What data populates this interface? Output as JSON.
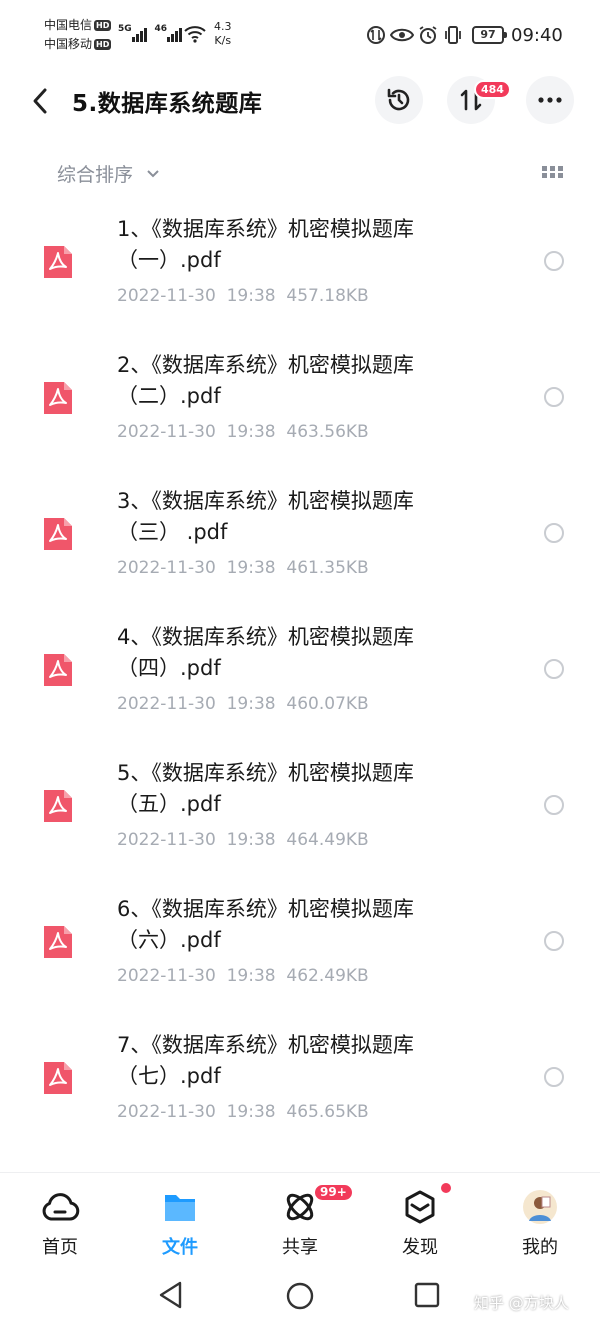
{
  "status": {
    "carrier1": "中国电信",
    "carrier2": "中国移动",
    "hd": "HD",
    "net1": "5G",
    "net2": "46",
    "speed_value": "4.3",
    "speed_unit": "K/s",
    "battery": "97",
    "time": "09:40"
  },
  "header": {
    "title": "5.数据库系统题库",
    "transfer_badge": "484"
  },
  "sort": {
    "label": "综合排序"
  },
  "files": [
    {
      "name_line1": "1、《数据库系统》机密模拟题库",
      "name_line2": "（一）.pdf",
      "date": "2022-11-30",
      "time": "19:38",
      "size": "457.18KB"
    },
    {
      "name_line1": "2、《数据库系统》机密模拟题库",
      "name_line2": "（二）.pdf",
      "date": "2022-11-30",
      "time": "19:38",
      "size": "463.56KB"
    },
    {
      "name_line1": "3、《数据库系统》机密模拟题库",
      "name_line2": "（三） .pdf",
      "date": "2022-11-30",
      "time": "19:38",
      "size": "461.35KB"
    },
    {
      "name_line1": "4、《数据库系统》机密模拟题库",
      "name_line2": "（四）.pdf",
      "date": "2022-11-30",
      "time": "19:38",
      "size": "460.07KB"
    },
    {
      "name_line1": "5、《数据库系统》机密模拟题库",
      "name_line2": "（五）.pdf",
      "date": "2022-11-30",
      "time": "19:38",
      "size": "464.49KB"
    },
    {
      "name_line1": "6、《数据库系统》机密模拟题库",
      "name_line2": "（六）.pdf",
      "date": "2022-11-30",
      "time": "19:38",
      "size": "462.49KB"
    },
    {
      "name_line1": "7、《数据库系统》机密模拟题库",
      "name_line2": "（七）.pdf",
      "date": "2022-11-30",
      "time": "19:38",
      "size": "465.65KB"
    }
  ],
  "tabs": {
    "home": "首页",
    "files": "文件",
    "share": "共享",
    "share_badge": "99+",
    "discover": "发现",
    "mine": "我的"
  },
  "watermark": "知乎 @方块人",
  "colors": {
    "accent": "#1e9bff",
    "pdf": "#f0566a",
    "badge": "#f23a5a"
  }
}
